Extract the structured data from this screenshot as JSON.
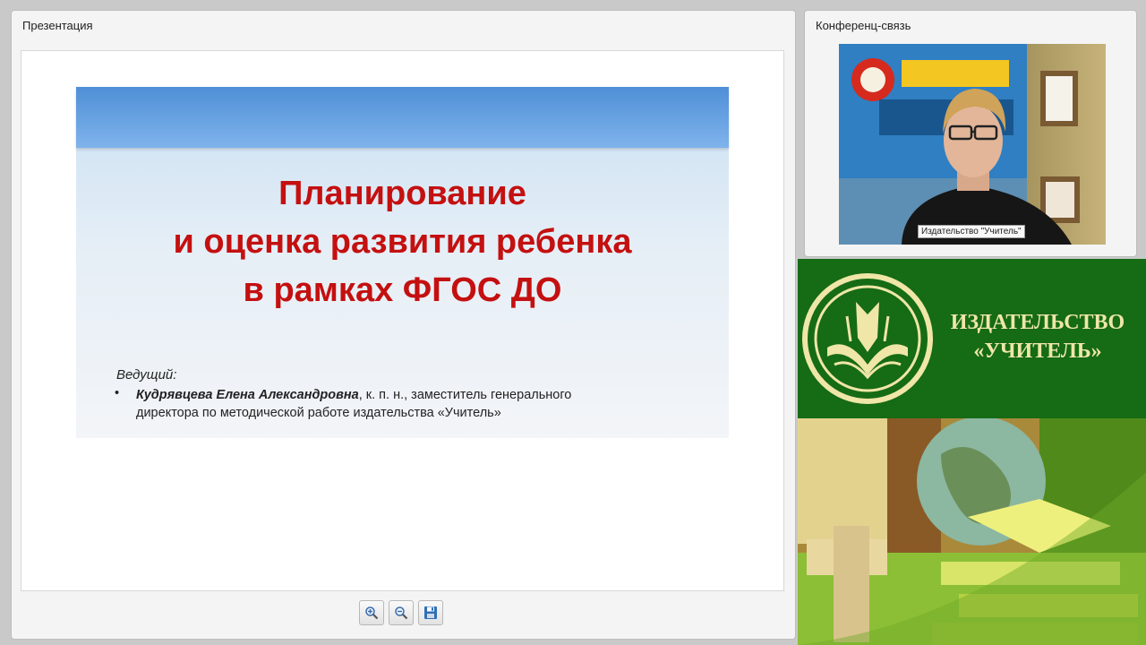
{
  "presentation_panel": {
    "title": "Презентация",
    "slide": {
      "title_lines": [
        "Планирование",
        "и оценка развития ребенка",
        "в рамках ФГОС ДО"
      ],
      "presenter_label": "Ведущий:",
      "bullet": "•",
      "presenter_name": "Кудрявцева Елена Александровна",
      "presenter_details_line1": ", к. п. н., заместитель генерального",
      "presenter_details_line2": "директора по методической работе издательства «Учитель»"
    },
    "toolbar": {
      "zoom_in_icon": "zoom-in-icon",
      "zoom_out_icon": "zoom-out-icon",
      "save_icon": "save-icon"
    }
  },
  "conference_panel": {
    "title": "Конференц-связь",
    "video_label": "Издательство \"Учитель\""
  },
  "brand": {
    "text_line1": "ИЗДАТЕЛЬСТВО",
    "text_line2": "«УЧИТЕЛЬ»",
    "colors": {
      "green": "#166b15",
      "gold": "#efe6a8"
    }
  },
  "colors": {
    "slide_title": "#c41010",
    "slide_header_bar": "#4f8fd6"
  }
}
